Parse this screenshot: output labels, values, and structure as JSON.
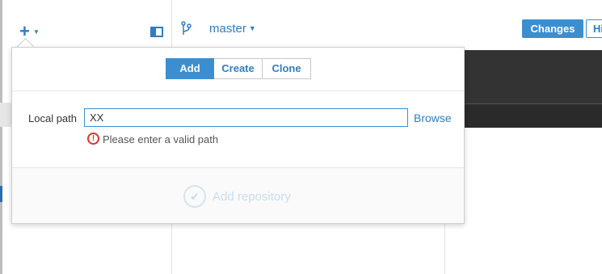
{
  "toolbar": {
    "add_icon": "plus-icon",
    "sidebar_toggle_icon": "sidebar-toggle-icon",
    "branch_icon": "git-branch-icon",
    "branch_name": "master",
    "tabs": {
      "changes": "Changes",
      "history": "Hi"
    }
  },
  "popover": {
    "segments": [
      "Add",
      "Create",
      "Clone"
    ],
    "active_segment": "Add",
    "local_path_label": "Local path",
    "local_path_value": "XX",
    "browse_label": "Browse",
    "error_message": "Please enter a valid path",
    "submit_label": "Add repository"
  },
  "colors": {
    "accent": "#3b8fd1",
    "error": "#d9352b",
    "disabled": "#c8dced"
  }
}
